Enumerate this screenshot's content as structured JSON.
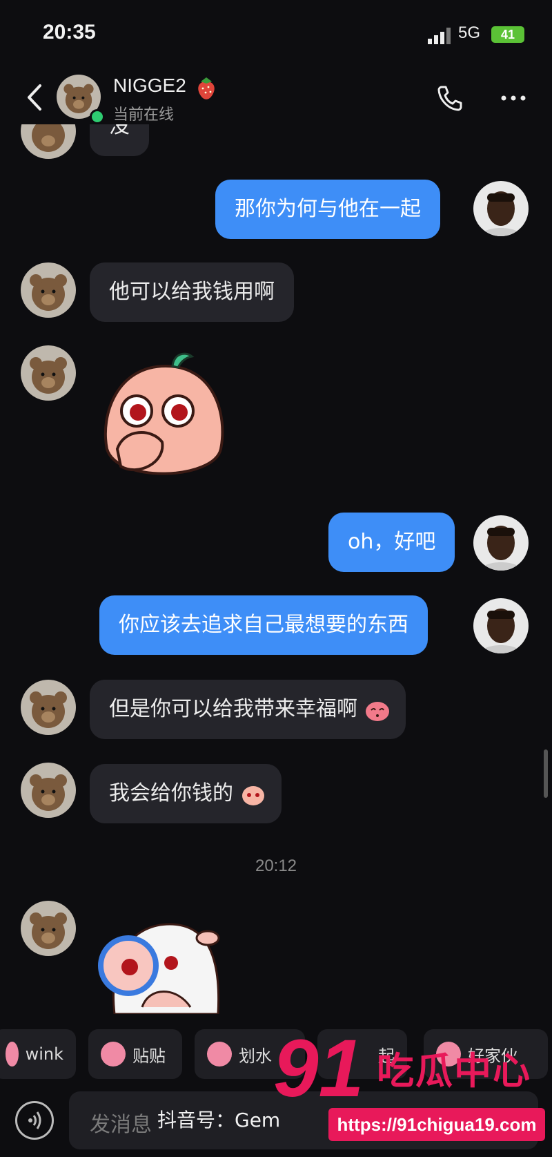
{
  "status_bar": {
    "time": "20:35",
    "network": "5G",
    "battery": "41"
  },
  "header": {
    "name": "NIGGE2",
    "status": "当前在线",
    "berry_emoji": "🍓"
  },
  "messages": [
    {
      "side": "in",
      "text": "没"
    },
    {
      "side": "out",
      "text": "那你为何与他在一起"
    },
    {
      "side": "in",
      "text": "他可以给我钱用啊"
    },
    {
      "side": "in",
      "type": "sticker",
      "sticker": "peach-thinking-sticker"
    },
    {
      "side": "out",
      "text": "oh，好吧"
    },
    {
      "side": "out",
      "text": "你应该去追求自己最想要的东西"
    },
    {
      "side": "in",
      "text": "但是你可以给我带来幸福啊"
    },
    {
      "side": "in",
      "text": "我会给你钱的"
    },
    {
      "side": "in",
      "type": "sticker",
      "sticker": "magnifier-sticker"
    }
  ],
  "timestamp": "20:12",
  "quick_replies": [
    "wink",
    "贴贴",
    "划水",
    "起",
    "好家伙"
  ],
  "input": {
    "placeholder": "发消息"
  },
  "watermarks": {
    "douyin": "抖音号：Gem",
    "brand_number": "91",
    "brand_text": "吃瓜中心",
    "url": "https://91chigua19.com"
  },
  "colors": {
    "outgoing_bubble": "#3e8ef7",
    "incoming_bubble": "#25252b",
    "background": "#0d0d10",
    "watermark": "#e8195a"
  }
}
